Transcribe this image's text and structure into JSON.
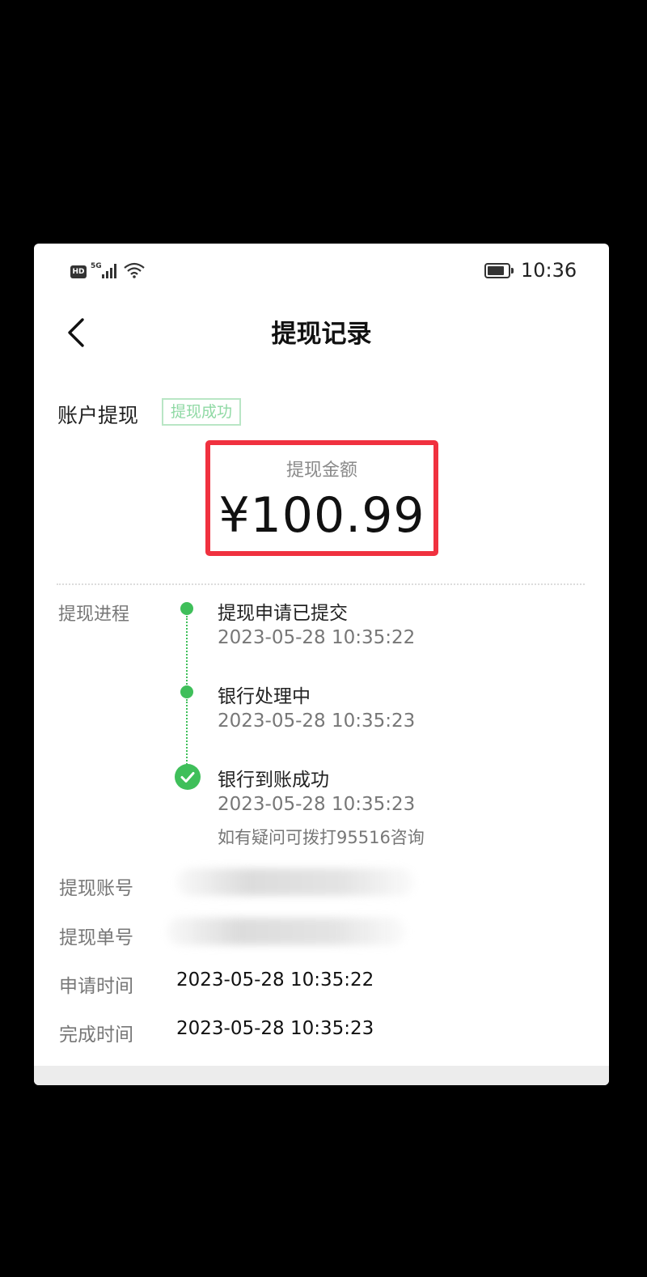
{
  "status_bar": {
    "network_badge": "HD",
    "network_type": "5G",
    "time": "10:36",
    "signal_icon": "signal-icon",
    "wifi_icon": "wifi-icon",
    "battery_icon": "battery-icon"
  },
  "nav": {
    "title": "提现记录",
    "back_icon": "chevron-left-icon"
  },
  "account": {
    "label": "账户提现",
    "status": "提现成功"
  },
  "amount": {
    "label": "提现金额",
    "value": "¥100.99"
  },
  "progress": {
    "label": "提现进程",
    "steps": [
      {
        "title": "提现申请已提交",
        "time": "2023-05-28 10:35:22"
      },
      {
        "title": "银行处理中",
        "time": "2023-05-28 10:35:23"
      },
      {
        "title": "银行到账成功",
        "time": "2023-05-28 10:35:23",
        "note": "如有疑问可拨打95516咨询"
      }
    ]
  },
  "details": {
    "account_number": {
      "label": "提现账号"
    },
    "order_number": {
      "label": "提现单号"
    },
    "apply_time": {
      "label": "申请时间",
      "value": "2023-05-28 10:35:22"
    },
    "complete_time": {
      "label": "完成时间",
      "value": "2023-05-28 10:35:23"
    }
  },
  "colors": {
    "accent_green": "#3fbf5a",
    "highlight_red": "#f0313f",
    "badge_green": "#8fd9a4"
  }
}
